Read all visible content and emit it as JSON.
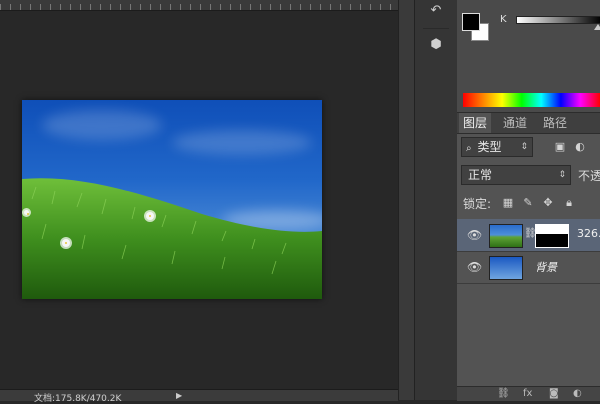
{
  "status": {
    "doc_info": "文档:175.8K/470.2K"
  },
  "color_panel": {
    "channel_label": "K",
    "k_value_percent": 93
  },
  "layers_panel": {
    "tabs": [
      {
        "label": "图层",
        "active": true
      },
      {
        "label": "通道",
        "active": false
      },
      {
        "label": "路径",
        "active": false
      }
    ],
    "filter": {
      "icon": "search-icon",
      "label": "类型"
    },
    "blend_mode": "正常",
    "opacity_label": "不透",
    "lock_label": "锁定:",
    "layers": [
      {
        "name": "326.",
        "selected": true,
        "has_mask": true,
        "thumb": "grass-and-sky"
      },
      {
        "name": "背景",
        "selected": false,
        "has_mask": false,
        "thumb": "sky"
      }
    ]
  }
}
